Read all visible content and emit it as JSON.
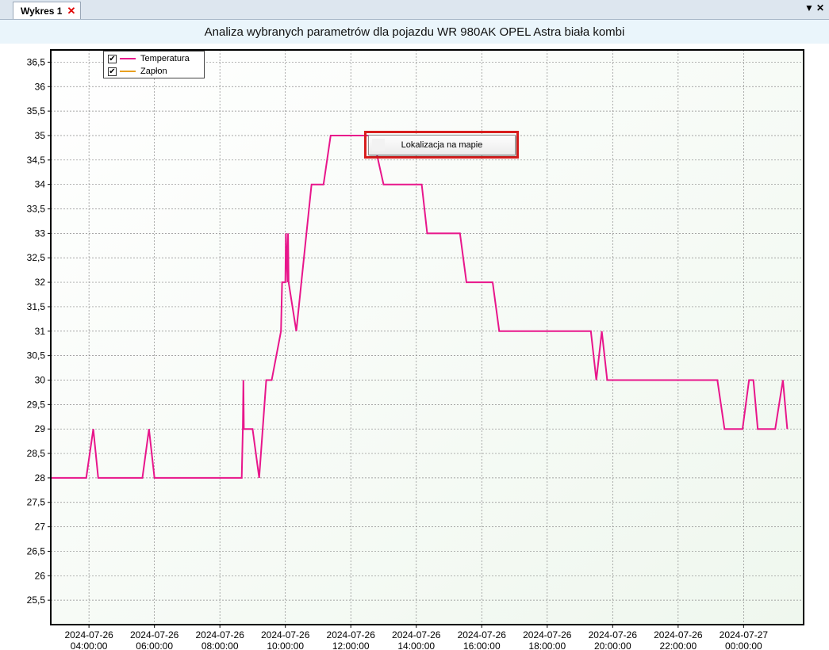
{
  "tabbar": {
    "tab_label": "Wykres 1",
    "close_glyph": "✕",
    "dropdown_glyph": "▼",
    "window_close_glyph": "✕"
  },
  "header": {
    "title": "Analiza wybranych parametrów dla pojazdu WR 980AK OPEL Astra biała kombi"
  },
  "context_menu": {
    "item_label": "Lokalizacja na mapie"
  },
  "legend": {
    "items": [
      {
        "label": "Temperatura",
        "color": "#e8168b",
        "checked": true,
        "check_glyph": "✔"
      },
      {
        "label": "Zapłon",
        "color": "#e8a020",
        "checked": true,
        "check_glyph": "✔"
      }
    ]
  },
  "chart_data": {
    "type": "line",
    "title": "Analiza wybranych parametrów dla pojazdu WR 980AK OPEL Astra biała kombi",
    "xlabel": "",
    "ylabel": "",
    "ylim": [
      25.0,
      36.75
    ],
    "xlim": [
      "2024-07-26 02:50",
      "2024-07-27 01:50"
    ],
    "grid": true,
    "legend_position": "top-left",
    "y_ticks": [
      "25,5",
      "26",
      "26,5",
      "27",
      "27,5",
      "28",
      "28,5",
      "29",
      "29,5",
      "30",
      "30,5",
      "31",
      "31,5",
      "32",
      "32,5",
      "33",
      "33,5",
      "34",
      "34,5",
      "35",
      "35,5",
      "36",
      "36,5"
    ],
    "x_ticks": [
      {
        "date": "2024-07-26",
        "time": "04:00:00"
      },
      {
        "date": "2024-07-26",
        "time": "06:00:00"
      },
      {
        "date": "2024-07-26",
        "time": "08:00:00"
      },
      {
        "date": "2024-07-26",
        "time": "10:00:00"
      },
      {
        "date": "2024-07-26",
        "time": "12:00:00"
      },
      {
        "date": "2024-07-26",
        "time": "14:00:00"
      },
      {
        "date": "2024-07-26",
        "time": "16:00:00"
      },
      {
        "date": "2024-07-26",
        "time": "18:00:00"
      },
      {
        "date": "2024-07-26",
        "time": "20:00:00"
      },
      {
        "date": "2024-07-26",
        "time": "22:00:00"
      },
      {
        "date": "2024-07-27",
        "time": "00:00:00"
      }
    ],
    "series": [
      {
        "name": "Temperatura",
        "color": "#e8168b",
        "points": [
          [
            "2024-07-26 02:50",
            28
          ],
          [
            "2024-07-26 03:55",
            28
          ],
          [
            "2024-07-26 04:08",
            29
          ],
          [
            "2024-07-26 04:17",
            28
          ],
          [
            "2024-07-26 05:38",
            28
          ],
          [
            "2024-07-26 05:50",
            29
          ],
          [
            "2024-07-26 06:00",
            28
          ],
          [
            "2024-07-26 08:40",
            28
          ],
          [
            "2024-07-26 08:42",
            29
          ],
          [
            "2024-07-26 08:43",
            30
          ],
          [
            "2024-07-26 08:44",
            29
          ],
          [
            "2024-07-26 09:00",
            29
          ],
          [
            "2024-07-26 09:12",
            28
          ],
          [
            "2024-07-26 09:25",
            30
          ],
          [
            "2024-07-26 09:35",
            30
          ],
          [
            "2024-07-26 09:52",
            31
          ],
          [
            "2024-07-26 09:54",
            32
          ],
          [
            "2024-07-26 10:00",
            32
          ],
          [
            "2024-07-26 10:01",
            33
          ],
          [
            "2024-07-26 10:04",
            32
          ],
          [
            "2024-07-26 10:05",
            33
          ],
          [
            "2024-07-26 10:06",
            32
          ],
          [
            "2024-07-26 10:20",
            31
          ],
          [
            "2024-07-26 10:48",
            34
          ],
          [
            "2024-07-26 11:10",
            34
          ],
          [
            "2024-07-26 11:23",
            35
          ],
          [
            "2024-07-26 12:30",
            35
          ],
          [
            "2024-07-26 12:40",
            35
          ],
          [
            "2024-07-26 13:00",
            34
          ],
          [
            "2024-07-26 14:10",
            34
          ],
          [
            "2024-07-26 14:20",
            33
          ],
          [
            "2024-07-26 15:20",
            33
          ],
          [
            "2024-07-26 15:32",
            32
          ],
          [
            "2024-07-26 16:20",
            32
          ],
          [
            "2024-07-26 16:32",
            31
          ],
          [
            "2024-07-26 19:20",
            31
          ],
          [
            "2024-07-26 19:30",
            30
          ],
          [
            "2024-07-26 19:40",
            31
          ],
          [
            "2024-07-26 19:50",
            30
          ],
          [
            "2024-07-26 23:12",
            30
          ],
          [
            "2024-07-26 23:25",
            29
          ],
          [
            "2024-07-26 23:58",
            29
          ],
          [
            "2024-07-27 00:10",
            30
          ],
          [
            "2024-07-27 00:18",
            30
          ],
          [
            "2024-07-27 00:26",
            29
          ],
          [
            "2024-07-27 00:58",
            29
          ],
          [
            "2024-07-27 01:12",
            30
          ],
          [
            "2024-07-27 01:20",
            29
          ]
        ]
      },
      {
        "name": "Zapłon",
        "color": "#e8a020",
        "points": []
      }
    ]
  }
}
